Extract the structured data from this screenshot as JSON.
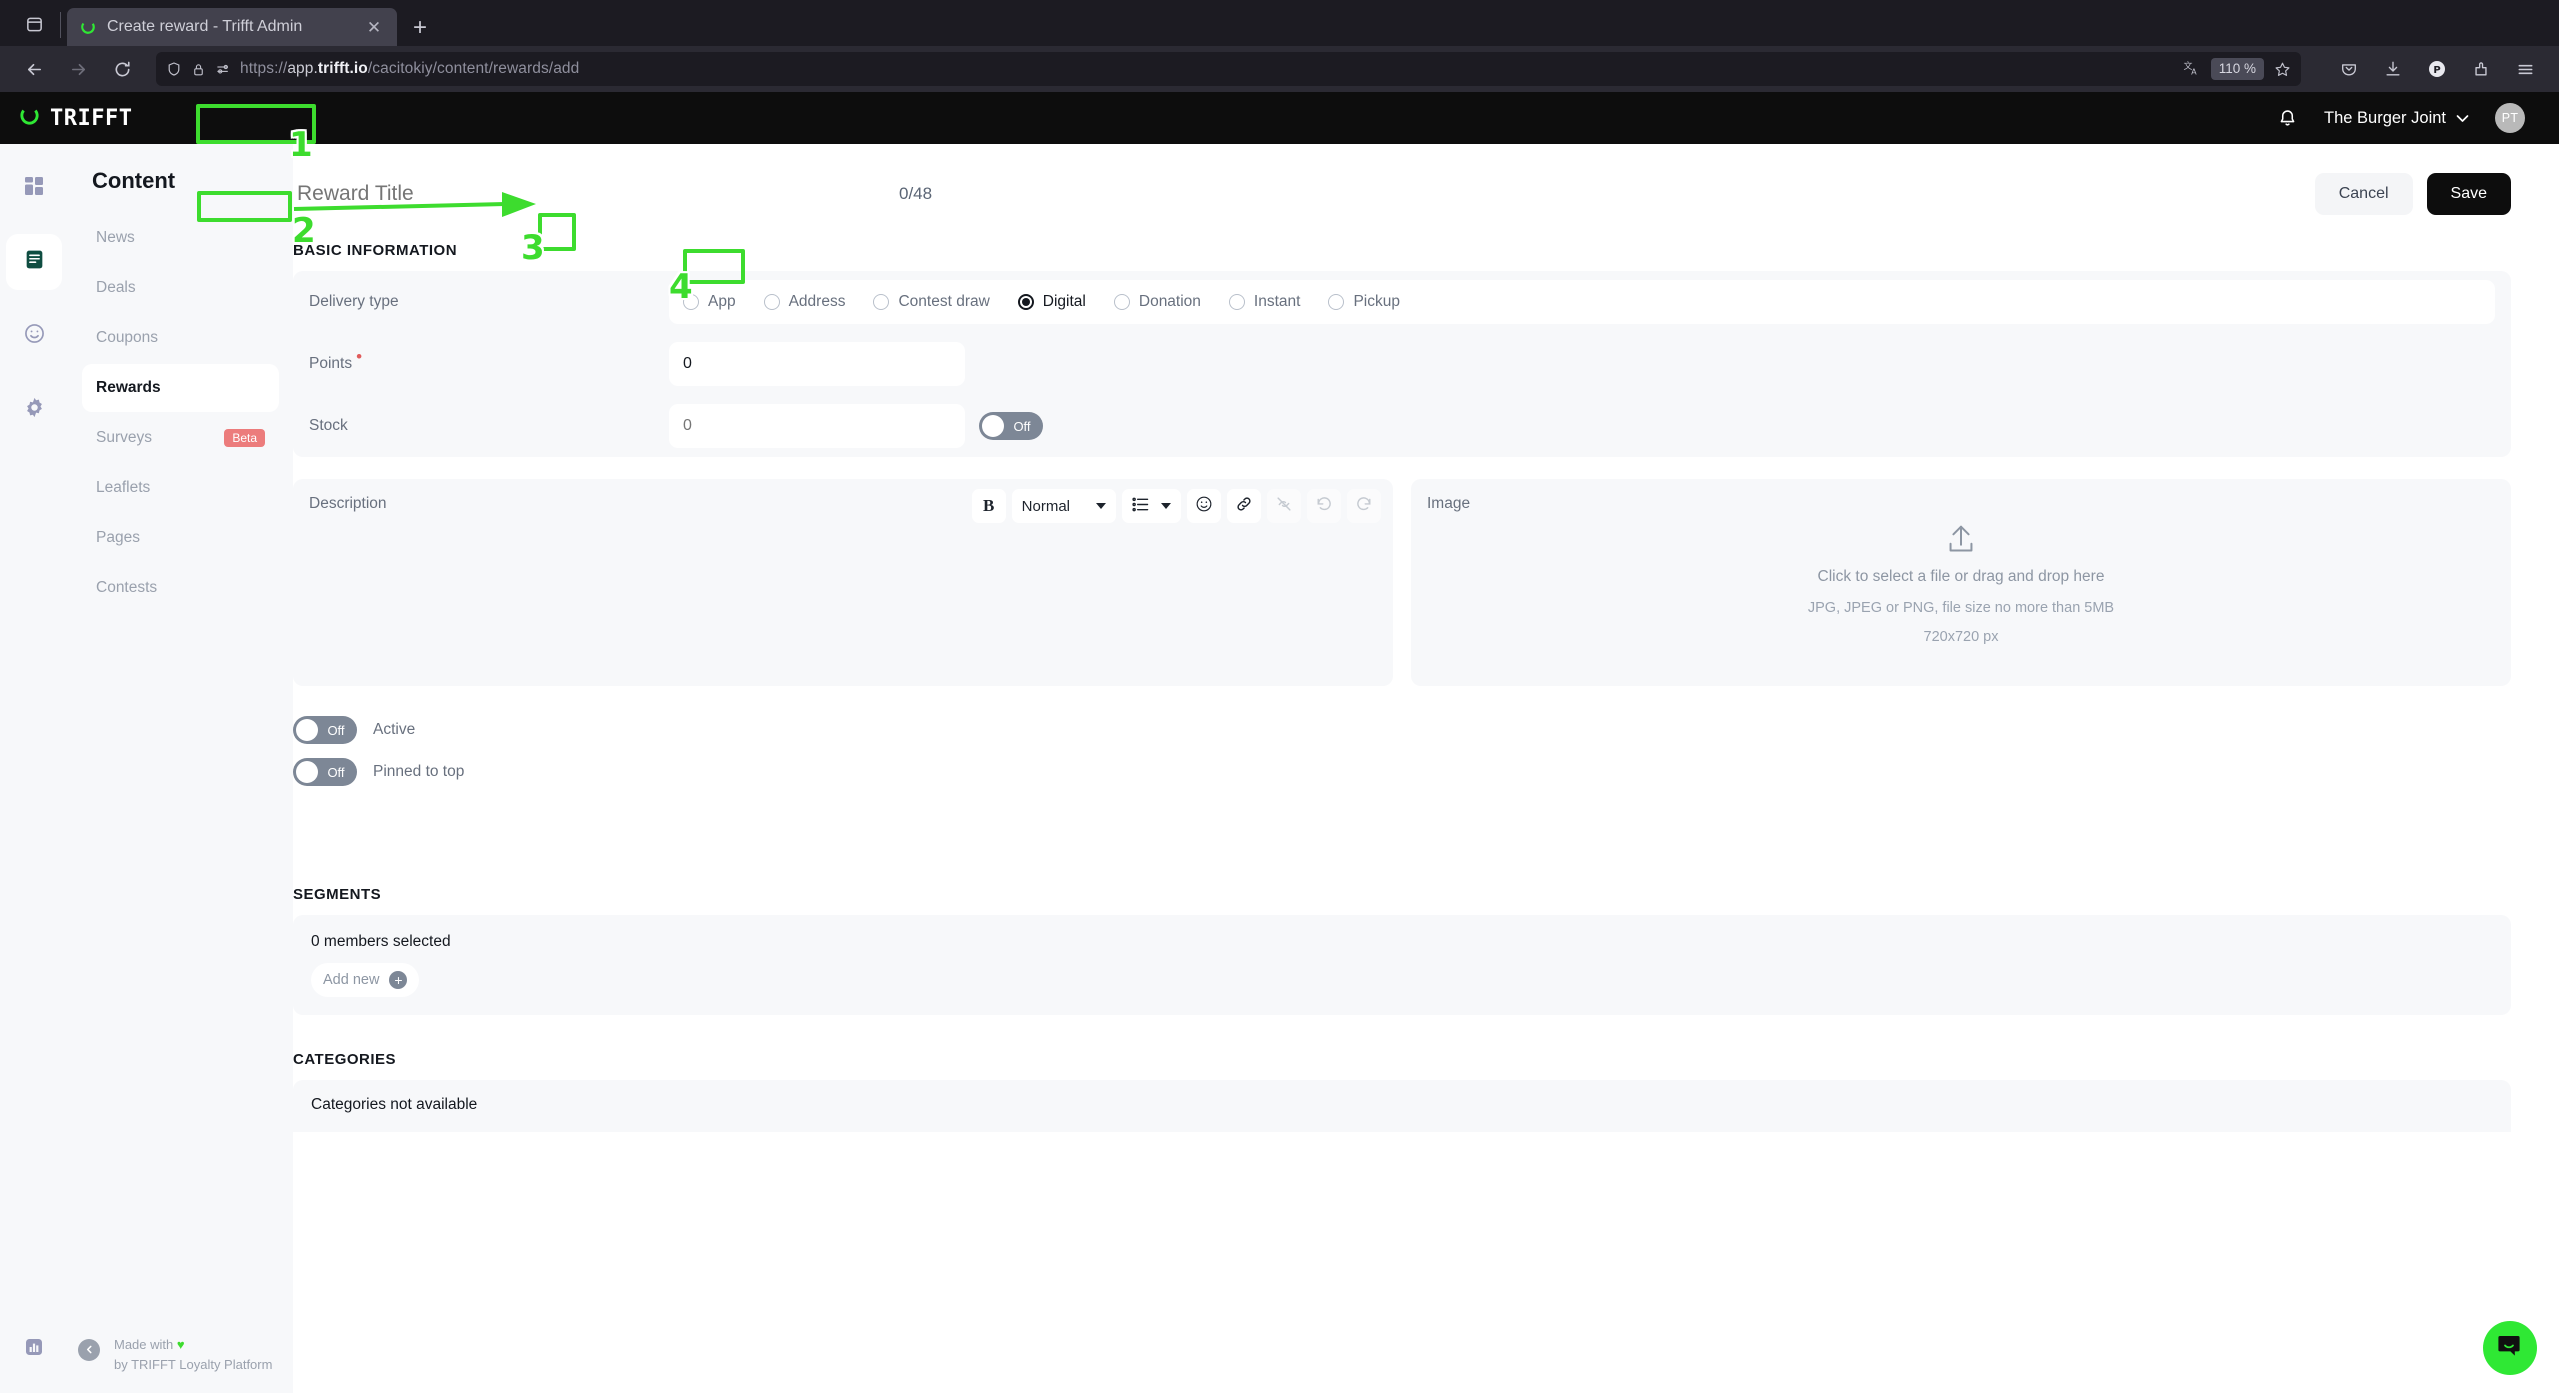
{
  "browser": {
    "tab": {
      "title": "Create reward - Trifft Admin",
      "favicon": "trifft-logo-icon",
      "close_label": "✕"
    },
    "new_tab_label": "+",
    "url": {
      "scheme": "https://",
      "host_pre": "app.",
      "host_bold": "trifft.io",
      "path": "/cacitokiy/content/rewards/add",
      "full": "https://app.trifft.io/cacitokiy/content/rewards/add"
    },
    "zoom_level": "110 %",
    "icons": {
      "back": "back-arrow-icon",
      "forward": "forward-arrow-icon",
      "reload": "reload-icon",
      "shield": "shield-icon",
      "lock": "lock-icon",
      "permissions": "permissions-icon",
      "translate": "translate-icon",
      "bookmark": "star-icon",
      "pocket": "pocket-icon",
      "downloads": "downloads-icon",
      "profile": "profile-icon",
      "extensions": "extensions-icon",
      "menu": "hamburger-menu-icon",
      "tablist": "tab-list-icon"
    },
    "profile_initial": "P"
  },
  "app_header": {
    "brand": "TRIFFT",
    "org_name": "The Burger Joint",
    "avatar_initials": "PT",
    "notifications_icon": "bell-icon",
    "chevron": "⌄"
  },
  "sidebar": {
    "title": "Content",
    "rail": [
      {
        "name": "dashboard",
        "icon": "grid-icon",
        "active": false
      },
      {
        "name": "content",
        "icon": "document-icon",
        "active": true
      },
      {
        "name": "engagement",
        "icon": "smiley-icon",
        "active": false
      },
      {
        "name": "settings",
        "icon": "gear-icon",
        "active": false
      }
    ],
    "rail_bottom": [
      {
        "name": "analytics",
        "icon": "bar-chart-icon"
      }
    ],
    "items": [
      {
        "label": "News",
        "active": false,
        "badge": null
      },
      {
        "label": "Deals",
        "active": false,
        "badge": null
      },
      {
        "label": "Coupons",
        "active": false,
        "badge": null
      },
      {
        "label": "Rewards",
        "active": true,
        "badge": null
      },
      {
        "label": "Surveys",
        "active": false,
        "badge": "Beta"
      },
      {
        "label": "Leaflets",
        "active": false,
        "badge": null
      },
      {
        "label": "Pages",
        "active": false,
        "badge": null
      },
      {
        "label": "Contests",
        "active": false,
        "badge": null
      }
    ],
    "footer_line1": "Made with",
    "footer_heart": "♥",
    "footer_line2": "by TRIFFT Loyalty Platform",
    "collapse_icon": "chevron-left-icon"
  },
  "page": {
    "title_value": "",
    "title_placeholder": "Reward Title",
    "char_count": "0/48",
    "cancel_label": "Cancel",
    "save_label": "Save",
    "sections": {
      "basic_information": "BASIC INFORMATION",
      "segments": "SEGMENTS",
      "categories": "CATEGORIES"
    },
    "delivery": {
      "label": "Delivery type",
      "options": [
        {
          "label": "App",
          "checked": false
        },
        {
          "label": "Address",
          "checked": false
        },
        {
          "label": "Contest draw",
          "checked": false
        },
        {
          "label": "Digital",
          "checked": true
        },
        {
          "label": "Donation",
          "checked": false
        },
        {
          "label": "Instant",
          "checked": false
        },
        {
          "label": "Pickup",
          "checked": false
        }
      ]
    },
    "points": {
      "label": "Points",
      "required": true,
      "value": "0",
      "placeholder": "0"
    },
    "stock": {
      "label": "Stock",
      "value": "",
      "placeholder": "0",
      "toggle_state": "Off"
    },
    "description": {
      "label": "Description",
      "toolbar": {
        "bold": "B",
        "style_value": "Normal",
        "list_icon": "bulleted-list-icon",
        "emoji_icon": "emoji-icon",
        "link_icon": "link-icon",
        "unlink_icon": "unlink-icon",
        "undo_icon": "undo-icon",
        "redo_icon": "redo-icon"
      }
    },
    "image": {
      "label": "Image",
      "upload_icon": "upload-icon",
      "cta": "Click to select a file or drag and drop here",
      "constraints": "JPG, JPEG or PNG, file size no more than 5MB",
      "dimensions": "720x720 px"
    },
    "toggles": [
      {
        "label": "Active",
        "state": "Off"
      },
      {
        "label": "Pinned to top",
        "state": "Off"
      }
    ],
    "segments": {
      "summary": "0 members selected",
      "add_label": "Add new",
      "add_icon": "plus-circle-icon"
    },
    "categories": {
      "empty_text": "Categories not available"
    }
  },
  "annotations": [
    {
      "number": "1",
      "target": "reward-title-input"
    },
    {
      "number": "2",
      "target": "delivery-type-label"
    },
    {
      "number": "3",
      "target": "points-input"
    },
    {
      "number": "4",
      "target": "stock-toggle"
    }
  ],
  "widget": {
    "intercom_icon": "chat-bubble-icon",
    "color": "#2fe834"
  }
}
